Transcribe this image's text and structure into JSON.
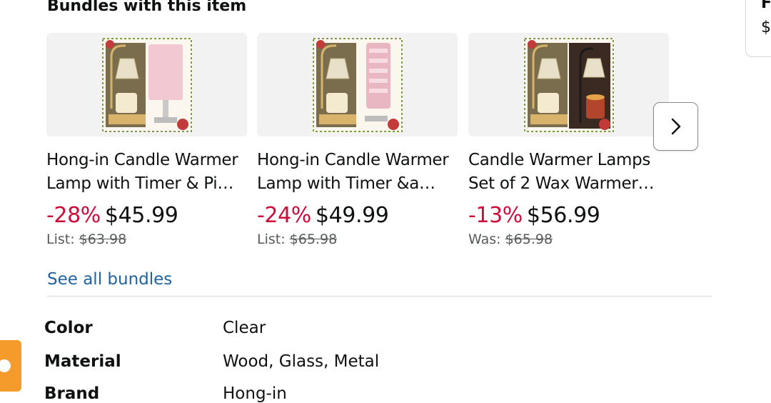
{
  "section": {
    "heading": "Bundles with this item",
    "see_all_label": "See all bundles",
    "next_icon": "chevron-right-icon"
  },
  "bundles": [
    {
      "title": "Hong-in Candle Warmer Lamp with Timer & Pi…",
      "discount": "-28%",
      "price": "$45.99",
      "list_label": "List:",
      "list_price": "$63.98",
      "thumb_second_color": "#f2c9d3"
    },
    {
      "title": "Hong-in Candle Warmer Lamp with Timer &a…",
      "discount": "-24%",
      "price": "$49.99",
      "list_label": "List:",
      "list_price": "$65.98",
      "thumb_second_color": "#e9b7c2"
    },
    {
      "title": "Candle Warmer Lamps Set of 2 Wax Warmer…",
      "discount": "-13%",
      "price": "$56.99",
      "list_label": "Was:",
      "list_price": "$65.98",
      "thumb_second_color": "#3a2a22"
    }
  ],
  "specs": [
    {
      "label": "Color",
      "value": "Clear"
    },
    {
      "label": "Material",
      "value": "Wood, Glass, Metal"
    },
    {
      "label": "Brand",
      "value": "Hong-in"
    }
  ],
  "side_panel": {
    "heading": "F",
    "price_symbol": "$"
  },
  "colors": {
    "discount": "#cc0c39",
    "link": "#2162a1",
    "accent_button": "#f59b2b"
  }
}
